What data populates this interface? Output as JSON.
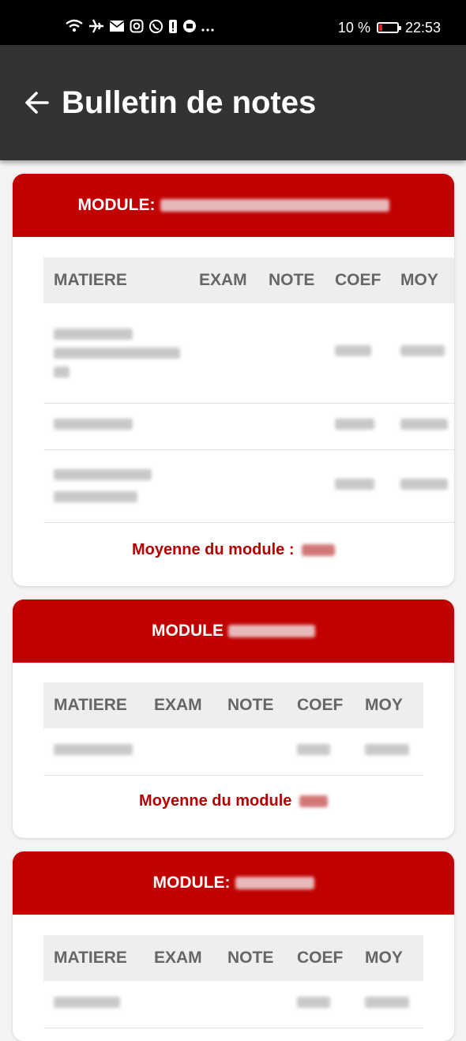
{
  "status_bar": {
    "icons": [
      "wifi-icon",
      "airplane-icon",
      "mail-icon",
      "instagram-icon",
      "whatsapp-icon",
      "battery-alert-icon",
      "app-icon",
      "more-icon"
    ],
    "battery_percent": "10 %",
    "time": "22:53",
    "battery_color": "#e02020"
  },
  "app_bar": {
    "title": "Bulletin de notes",
    "back_icon": "arrow-left-icon"
  },
  "colors": {
    "accent": "#c10000",
    "app_bar_bg": "#333333",
    "average_text": "#b30000"
  },
  "modules": [
    {
      "label": "MODULE:",
      "columns": [
        "MATIERE",
        "EXAM",
        "NOTE",
        "COEF",
        "MOY"
      ],
      "rows": 3,
      "average_label": "Moyenne du module :"
    },
    {
      "label": "MODULE",
      "columns": [
        "MATIERE",
        "EXAM",
        "NOTE",
        "COEF",
        "MOY"
      ],
      "rows": 1,
      "average_label": "Moyenne du module"
    },
    {
      "label": "MODULE:",
      "columns": [
        "MATIERE",
        "EXAM",
        "NOTE",
        "COEF",
        "MOY"
      ],
      "rows": 1,
      "average_label": ""
    }
  ]
}
